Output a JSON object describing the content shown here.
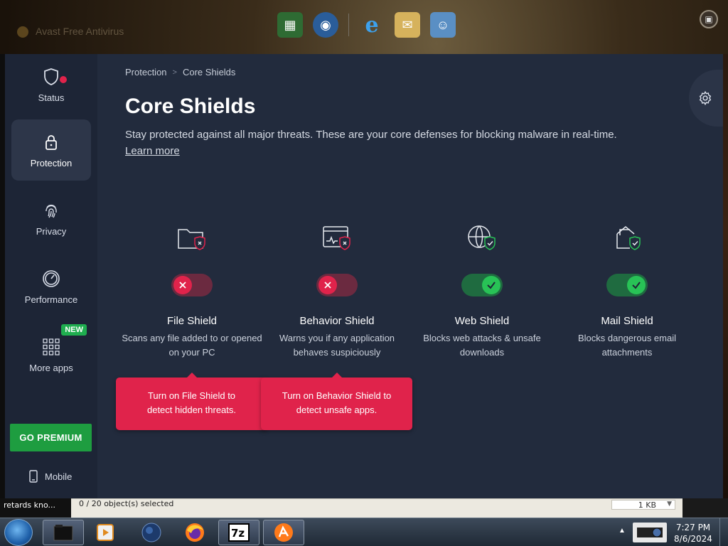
{
  "background_window": {
    "title": "Avast Free Antivirus"
  },
  "sidebar": {
    "items": [
      {
        "label": "Status",
        "icon": "shield-alert-icon"
      },
      {
        "label": "Protection",
        "icon": "lock-icon"
      },
      {
        "label": "Privacy",
        "icon": "fingerprint-icon"
      },
      {
        "label": "Performance",
        "icon": "speedometer-icon"
      },
      {
        "label": "More apps",
        "icon": "apps-grid-icon",
        "badge": "NEW"
      }
    ],
    "premium_label": "GO PREMIUM",
    "mobile_label": "Mobile"
  },
  "breadcrumb": {
    "parent": "Protection",
    "current": "Core Shields"
  },
  "page": {
    "title": "Core Shields",
    "description": "Stay protected against all major threats. These are your core defenses for blocking malware in real-time.",
    "learn_more": "Learn more"
  },
  "shields": [
    {
      "name": "File Shield",
      "description": "Scans any file added to or opened on your PC",
      "enabled": false,
      "icon": "folder-shield-icon"
    },
    {
      "name": "Behavior Shield",
      "description": "Warns you if any application behaves suspiciously",
      "enabled": false,
      "icon": "app-window-shield-icon"
    },
    {
      "name": "Web Shield",
      "description": "Blocks web attacks & unsafe downloads",
      "enabled": true,
      "icon": "globe-shield-icon"
    },
    {
      "name": "Mail Shield",
      "description": "Blocks dangerous email attachments",
      "enabled": true,
      "icon": "mail-shield-icon"
    }
  ],
  "tooltips": [
    {
      "text": "Turn on File Shield to detect hidden threats."
    },
    {
      "text": "Turn on Behavior Shield to detect unsafe apps."
    }
  ],
  "explorer_status": {
    "left_text": "retards kno...",
    "selection": "0 / 20 object(s) selected",
    "size": "1 KB"
  },
  "taskbar": {
    "time": "7:27 PM",
    "date": "8/6/2024"
  },
  "colors": {
    "app_bg": "#222b3d",
    "sidebar_bg": "#1d2536",
    "toggle_off": "#e0234b",
    "toggle_on": "#28c256",
    "premium": "#1e9d40"
  }
}
